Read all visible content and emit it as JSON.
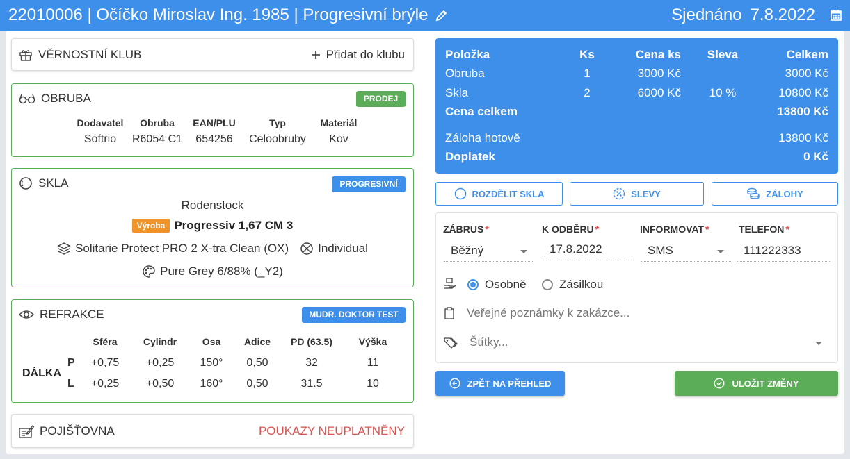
{
  "header": {
    "title": "22010006 | Očíčko Miroslav Ing. 1985 | Progresivní brýle",
    "status_label": "Sjednáno",
    "status_date": "7.8.2022"
  },
  "loyalty": {
    "title": "VĚRNOSTNÍ KLUB",
    "add_label": "Přidat do klubu"
  },
  "frame": {
    "title": "OBRUBA",
    "badge": "PRODEJ",
    "columns": [
      "Dodavatel",
      "Obruba",
      "EAN/PLU",
      "Typ",
      "Materiál"
    ],
    "values": [
      "Softrio",
      "R6054 C1",
      "654256",
      "Celoobruby",
      "Kov"
    ]
  },
  "lenses": {
    "title": "SKLA",
    "badge": "PROGRESIVNÍ",
    "brand": "Rodenstock",
    "tag": "Výroba",
    "product": "Progressiv 1,67 CM 3",
    "coating": "Solitarie Protect PRO 2 X-tra Clean (OX)",
    "design": "Individual",
    "tint": "Pure Grey 6/88% (_Y2)"
  },
  "refraction": {
    "title": "REFRAKCE",
    "badge": "MUDR. DOKTOR TEST",
    "columns": [
      "Sféra",
      "Cylindr",
      "Osa",
      "Adice",
      "PD (63.5)",
      "Výška"
    ],
    "group": "DÁLKA",
    "rows": [
      {
        "eye": "P",
        "values": [
          "+0,75",
          "+0,25",
          "150°",
          "0,50",
          "32",
          "11"
        ]
      },
      {
        "eye": "L",
        "values": [
          "+0,25",
          "+0,50",
          "160°",
          "0,50",
          "31.5",
          "10"
        ]
      }
    ]
  },
  "insurance": {
    "title": "POJIŠŤOVNA",
    "status": "POUKAZY NEUPLATNĚNY",
    "status_color": "#d9534f"
  },
  "summary": {
    "headers": {
      "item": "Položka",
      "qty": "Ks",
      "price": "Cena ks",
      "discount": "Sleva",
      "total": "Celkem"
    },
    "rows": [
      {
        "item": "Obruba",
        "qty": "1",
        "price": "3000 Kč",
        "discount": "",
        "total": "3000 Kč"
      },
      {
        "item": "Skla",
        "qty": "2",
        "price": "6000 Kč",
        "discount": "10 %",
        "total": "10800 Kč"
      }
    ],
    "total_label": "Cena celkem",
    "total_value": "13800 Kč",
    "deposit_label": "Záloha hotově",
    "deposit_value": "13800 Kč",
    "remaining_label": "Doplatek",
    "remaining_value": "0 Kč"
  },
  "actions": {
    "split": "ROZDĚLIT SKLA",
    "discounts": "SLEVY",
    "deposits": "ZÁLOHY",
    "back": "ZPĚT NA PŘEHLED",
    "save": "ULOŽIT ZMĚNY"
  },
  "form": {
    "urgency": {
      "label": "ZÁBRUS",
      "value": "Běžný"
    },
    "pickup": {
      "label": "K ODBĚRU",
      "value": "17.8.2022"
    },
    "notify": {
      "label": "INFORMOVAT",
      "value": "SMS"
    },
    "phone": {
      "label": "TELEFON",
      "value": "111222333"
    },
    "delivery": {
      "personal": "Osobně",
      "post": "Zásilkou"
    },
    "notes_placeholder": "Veřejné poznámky k zakázce...",
    "tags_placeholder": "Štítky..."
  },
  "colors": {
    "primary": "#3d8fe9",
    "success": "#5cad58",
    "warning_tag": "#f0932b",
    "required": "#e04848"
  }
}
